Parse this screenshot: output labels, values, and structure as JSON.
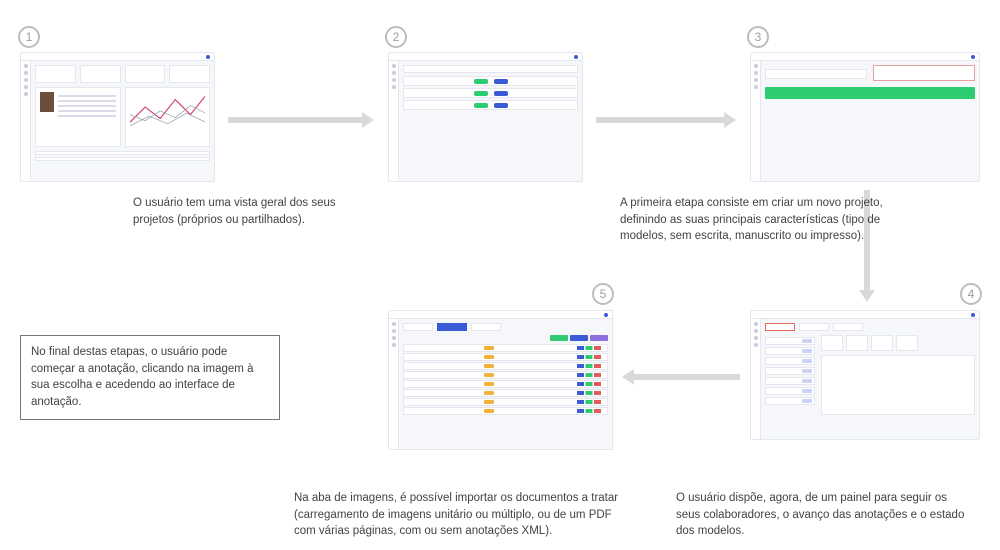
{
  "steps": {
    "s1": {
      "num": "1"
    },
    "s2": {
      "num": "2"
    },
    "s3": {
      "num": "3"
    },
    "s4": {
      "num": "4"
    },
    "s5": {
      "num": "5"
    }
  },
  "captions": {
    "c1": "O usuário tem uma vista geral dos seus projetos (próprios ou partilhados).",
    "c2": "A primeira etapa consiste em criar um novo projeto, definindo as suas principais características (tipo de modelos, sem escrita, manuscrito ou impresso).",
    "c4": "O usuário dispõe, agora, de um painel para seguir os seus colaboradores, o avanço das anotações e o estado dos modelos.",
    "c5": "Na aba de imagens, é possível importar os documentos a tratar (carregamento de imagens unitário ou múltiplo, ou de um PDF com várias páginas, com ou sem anotações XML).",
    "final": "No final destas etapas, o usuário pode começar a anotação, clicando na imagem à sua escolha e acedendo ao interface de anotação."
  }
}
